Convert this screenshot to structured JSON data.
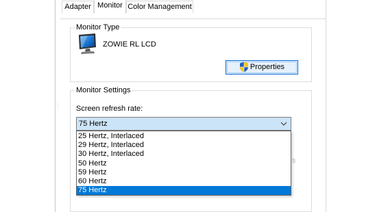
{
  "tabs": [
    {
      "label": "Adapter",
      "selected": false
    },
    {
      "label": "Monitor",
      "selected": true
    },
    {
      "label": "Color Management",
      "selected": false
    }
  ],
  "monitor_type": {
    "group_title": "Monitor Type",
    "monitor_name": "ZOWIE RL LCD",
    "properties_button": "Properties",
    "icon": "monitor-icon",
    "button_icon": "uac-shield-icon"
  },
  "monitor_settings": {
    "group_title": "Monitor Settings",
    "refresh_label": "Screen refresh rate:",
    "selected_value": "75 Hertz",
    "options": [
      "25 Hertz, Interlaced",
      "29 Hertz, Interlaced",
      "30 Hertz, Interlaced",
      "50 Hertz",
      "59 Hertz",
      "60 Hertz",
      "75 Hertz"
    ],
    "selected_index": 6,
    "partial_hidden_text": "s"
  },
  "colors": {
    "selection": "#0078d7",
    "select_bg": "#cce4f7",
    "button_bg": "#e5f1fb",
    "button_border": "#0a6bd6"
  }
}
